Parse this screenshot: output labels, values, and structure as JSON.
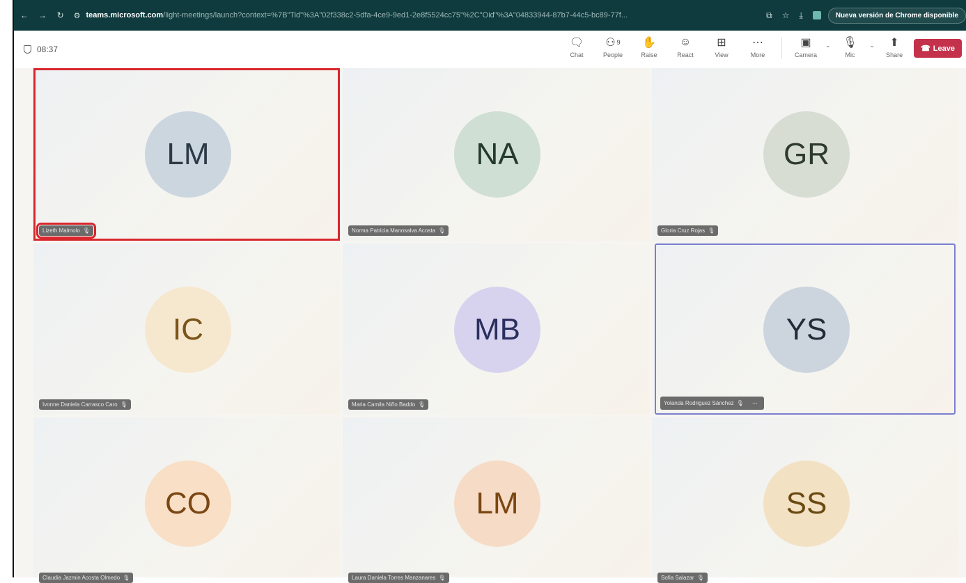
{
  "browser": {
    "url_host": "teams.microsoft.com",
    "url_path": "/light-meetings/launch?context=%7B\"Tid\"%3A\"02f338c2-5dfa-4ce9-9ed1-2e8f5524cc75\"%2C\"Oid\"%3A\"04833944-87b7-44c5-bc89-77f...",
    "update_label": "Nueva versión de Chrome disponible"
  },
  "meeting": {
    "timer": "08:37",
    "people_count": "9",
    "tools": {
      "chat": "Chat",
      "people": "People",
      "raise": "Raise",
      "react": "React",
      "view": "View",
      "more": "More",
      "camera": "Camera",
      "mic": "Mic",
      "share": "Share",
      "leave": "Leave"
    }
  },
  "colors": {
    "highlight_red": "#d9262c",
    "active_speaker": "#7b7fcf",
    "leave": "#c4314b"
  },
  "participants": [
    {
      "initials": "LM",
      "name": "Lizeth Malmolo",
      "bg": "#ccd6df",
      "fg": "#2d3a46"
    },
    {
      "initials": "NA",
      "name": "Norma Patricia Manosalva Acosta",
      "bg": "#cfdfd3",
      "fg": "#243a2d"
    },
    {
      "initials": "GR",
      "name": "Gloria Cruz Rojas",
      "bg": "#d7ddd3",
      "fg": "#2f3a2f"
    },
    {
      "initials": "IC",
      "name": "Ivonne Daniela Carrasco Caro",
      "bg": "#f6e7cf",
      "fg": "#7a5418"
    },
    {
      "initials": "MB",
      "name": "Maria Camila Niño Baddo",
      "bg": "#d7d3ee",
      "fg": "#2b2f5e"
    },
    {
      "initials": "YS",
      "name": "Yolanda Rodriguez Sánchez",
      "bg": "#ccd5de",
      "fg": "#222c38"
    },
    {
      "initials": "CO",
      "name": "Claudia Jazmin Acosta Olmedo",
      "bg": "#f8dfc6",
      "fg": "#7a4612"
    },
    {
      "initials": "LM",
      "name": "Laura Daniela Torres Manzanares",
      "bg": "#f6dcc6",
      "fg": "#7a4612"
    },
    {
      "initials": "SS",
      "name": "Sofia Salazar",
      "bg": "#f3e1c4",
      "fg": "#6a4a12"
    }
  ]
}
